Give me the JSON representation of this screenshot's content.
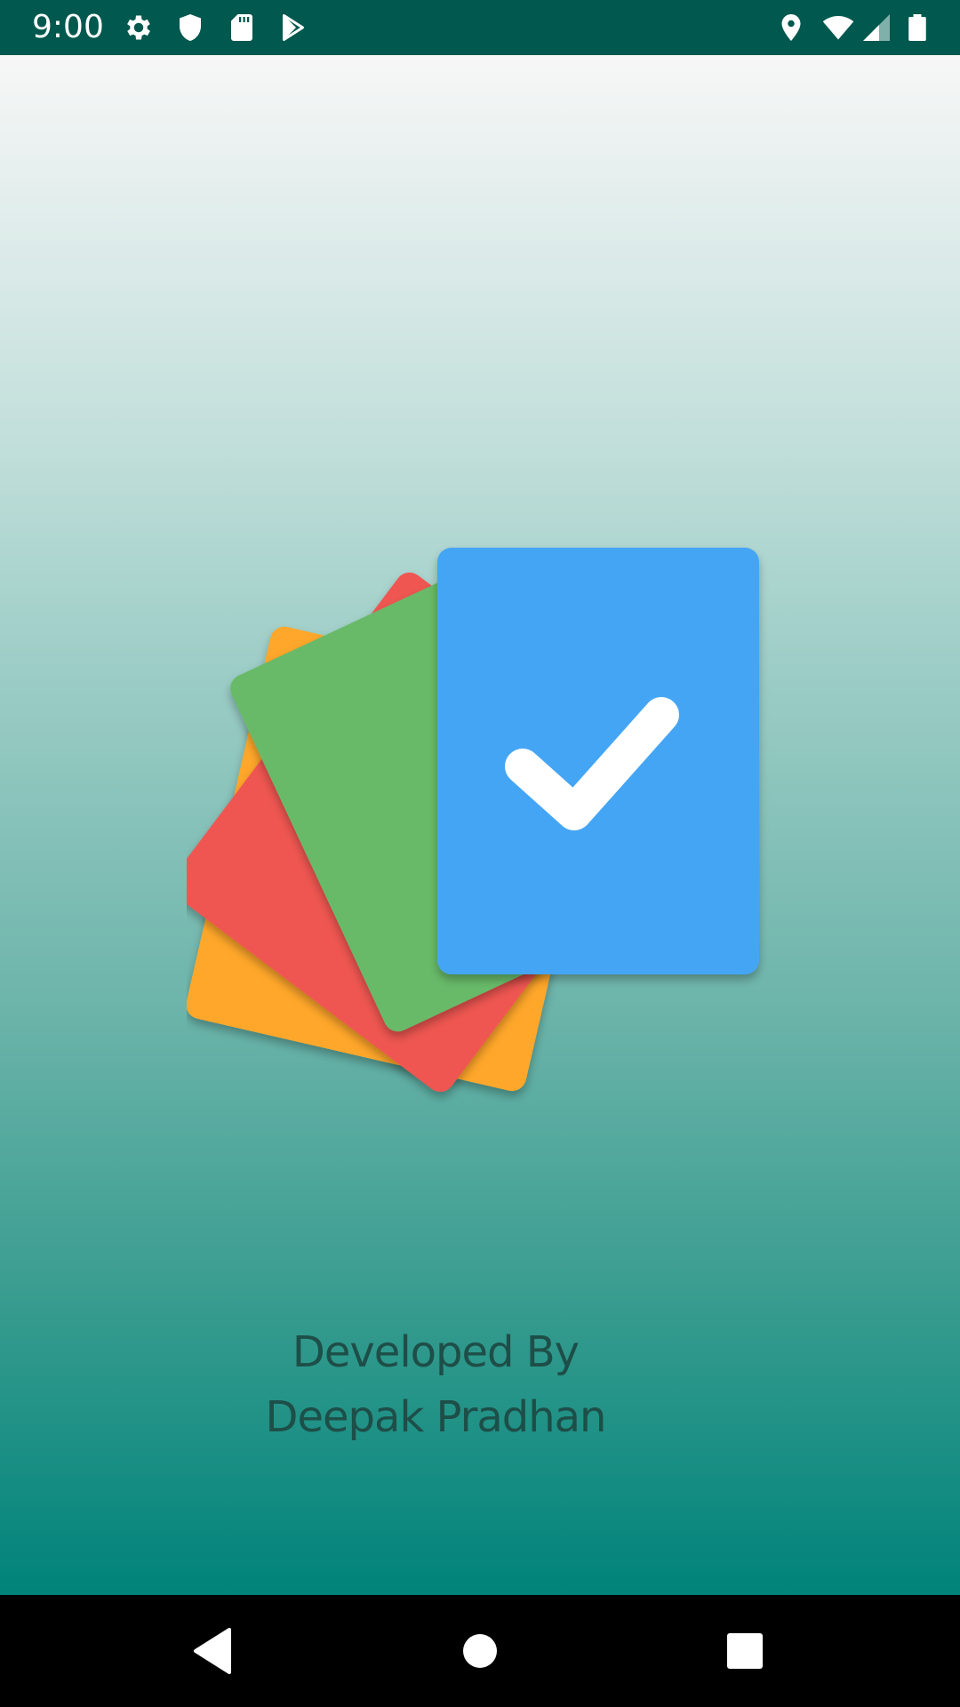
{
  "status_bar": {
    "time": "9:00",
    "background_color": "#00584e",
    "left_icons": [
      "settings-icon",
      "shield-icon",
      "sd-card-icon",
      "play-store-icon"
    ],
    "right_icons": [
      "location-icon",
      "wifi-icon",
      "signal-icon",
      "battery-icon"
    ]
  },
  "splash": {
    "logo_icon": "stacked-cards-checkmark-icon",
    "credit_line1": "Developed By",
    "credit_line2": "Deepak Pradhan",
    "colors": {
      "card_orange": "#ffa72b",
      "card_red": "#ef5651",
      "card_green": "#67ba69",
      "card_blue": "#45a5f5",
      "text": "#1e4e48"
    }
  },
  "nav_bar": {
    "buttons": [
      "back-icon",
      "home-icon",
      "recents-icon"
    ]
  }
}
